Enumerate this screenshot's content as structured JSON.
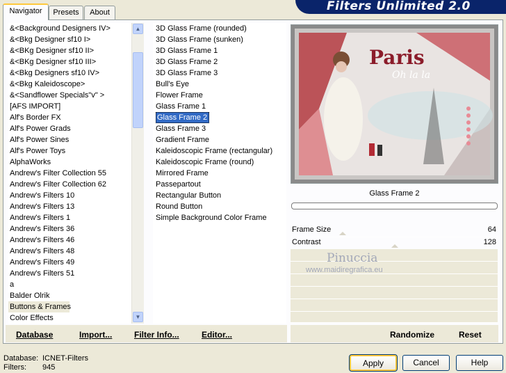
{
  "banner_title": "Filters Unlimited 2.0",
  "tabs": [
    {
      "label": "Navigator"
    },
    {
      "label": "Presets"
    },
    {
      "label": "About"
    }
  ],
  "categories": [
    "&<Background Designers IV>",
    "&<Bkg Designer sf10 I>",
    "&<BKg Designer sf10 II>",
    "&<BKg Designer sf10 III>",
    "&<Bkg Designers sf10 IV>",
    "&<Bkg Kaleidoscope>",
    "&<Sandflower Specials\"v\" >",
    "[AFS IMPORT]",
    "Alf's Border FX",
    "Alf's Power Grads",
    "Alf's Power Sines",
    "Alf's Power Toys",
    "AlphaWorks",
    "Andrew's Filter Collection 55",
    "Andrew's Filter Collection 62",
    "Andrew's Filters 10",
    "Andrew's Filters 13",
    "Andrew's Filters 1",
    "Andrew's Filters 36",
    "Andrew's Filters 46",
    "Andrew's Filters 48",
    "Andrew's Filters 49",
    "Andrew's Filters 51",
    "a",
    "Balder Olrik",
    "Buttons & Frames",
    "Color Effects"
  ],
  "filters": [
    "3D Glass Frame (rounded)",
    "3D Glass Frame (sunken)",
    "3D Glass Frame 1",
    "3D Glass Frame 2",
    "3D Glass Frame 3",
    "Bull's Eye",
    "Flower Frame",
    "Glass Frame 1",
    "Glass Frame 2",
    "Glass Frame 3",
    "Gradient Frame",
    "Kaleidoscopic Frame (rectangular)",
    "Kaleidoscopic Frame (round)",
    "Mirrored Frame",
    "Passepartout",
    "Rectangular Button",
    "Round Button",
    "Simple Background Color Frame"
  ],
  "left_toolbar": {
    "database": "Database",
    "import": "Import...",
    "filter_info": "Filter Info...",
    "editor": "Editor..."
  },
  "right_toolbar": {
    "randomize": "Randomize",
    "reset": "Reset"
  },
  "preview": {
    "headline": "Paris",
    "subline": "Oh la la"
  },
  "selected_filter_title": "Glass Frame 2",
  "params": [
    {
      "label": "Frame Size",
      "value": "64"
    },
    {
      "label": "Contrast",
      "value": "128"
    }
  ],
  "watermark": {
    "name": "Pinuccia",
    "site": "www.maidiregrafica.eu"
  },
  "status": {
    "database_label": "Database:",
    "database_value": "ICNET-Filters",
    "filters_label": "Filters:",
    "filters_value": "945"
  },
  "buttons": {
    "apply": "Apply",
    "cancel": "Cancel",
    "help": "Help"
  }
}
